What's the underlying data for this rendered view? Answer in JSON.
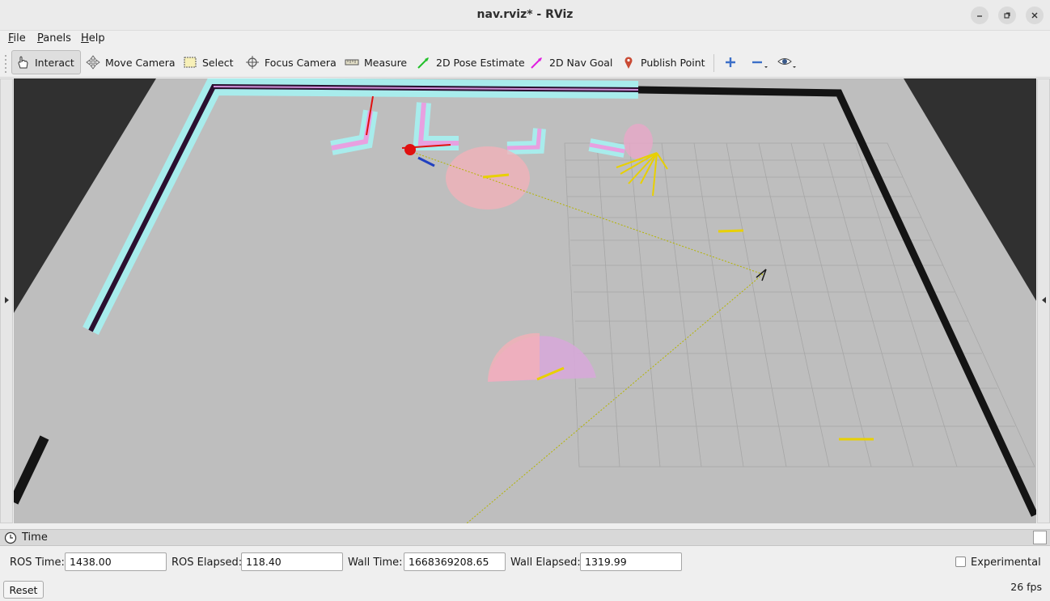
{
  "window": {
    "title": "nav.rviz* - RViz"
  },
  "menu": [
    "File",
    "Panels",
    "Help"
  ],
  "toolbar": {
    "tools": [
      {
        "label": "Interact",
        "icon": "hand-pointer-icon",
        "active": true
      },
      {
        "label": "Move Camera",
        "icon": "move-camera-icon"
      },
      {
        "label": "Select",
        "icon": "select-box-icon"
      },
      {
        "label": "Focus Camera",
        "icon": "crosshair-icon"
      },
      {
        "label": "Measure",
        "icon": "ruler-icon"
      },
      {
        "label": "2D Pose Estimate",
        "icon": "green-arrow-icon",
        "color": "#22c02a"
      },
      {
        "label": "2D Nav Goal",
        "icon": "magenta-arrow-icon",
        "color": "#e01ee0"
      },
      {
        "label": "Publish Point",
        "icon": "map-pin-icon",
        "color": "#c94a34"
      }
    ],
    "extra_icons": [
      "plus-icon",
      "minus-icon",
      "eye-icon"
    ]
  },
  "time_panel": {
    "title": "Time",
    "ros_time_label": "ROS Time:",
    "ros_time_value": "1438.00",
    "ros_elapsed_label": "ROS Elapsed:",
    "ros_elapsed_value": "118.40",
    "wall_time_label": "Wall Time:",
    "wall_time_value": "1668369208.65",
    "wall_elapsed_label": "Wall Elapsed:",
    "wall_elapsed_value": "1319.99",
    "experimental_label": "Experimental",
    "experimental_checked": false,
    "reset_label": "Reset",
    "fps": "26 fps"
  },
  "colors": {
    "map_background": "#bebebe",
    "costmap_inflation": "#a8ecec",
    "wall": "#1a1a1a",
    "path": "#c8c800",
    "particle_arrows": "#e8d000"
  }
}
